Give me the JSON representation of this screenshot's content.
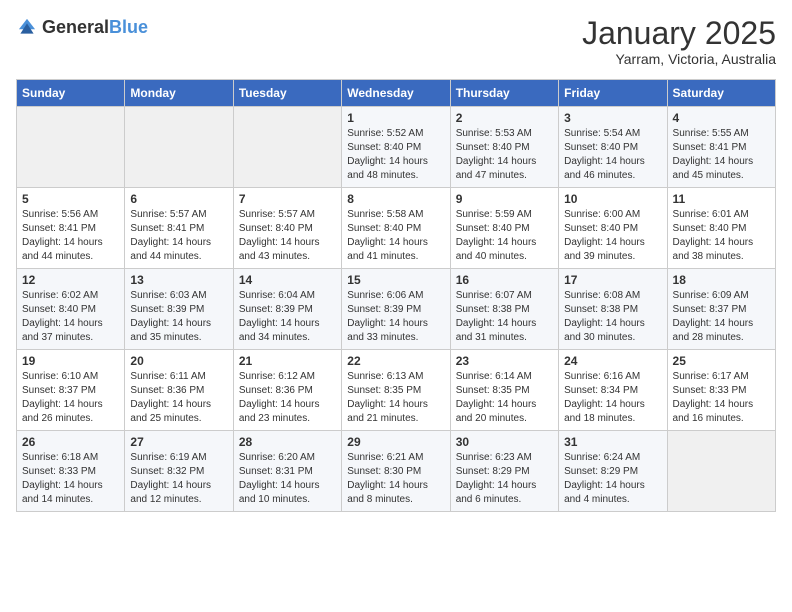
{
  "header": {
    "logo_general": "General",
    "logo_blue": "Blue",
    "title": "January 2025",
    "subtitle": "Yarram, Victoria, Australia"
  },
  "calendar": {
    "days_of_week": [
      "Sunday",
      "Monday",
      "Tuesday",
      "Wednesday",
      "Thursday",
      "Friday",
      "Saturday"
    ],
    "weeks": [
      [
        {
          "day": "",
          "info": ""
        },
        {
          "day": "",
          "info": ""
        },
        {
          "day": "",
          "info": ""
        },
        {
          "day": "1",
          "info": "Sunrise: 5:52 AM\nSunset: 8:40 PM\nDaylight: 14 hours\nand 48 minutes."
        },
        {
          "day": "2",
          "info": "Sunrise: 5:53 AM\nSunset: 8:40 PM\nDaylight: 14 hours\nand 47 minutes."
        },
        {
          "day": "3",
          "info": "Sunrise: 5:54 AM\nSunset: 8:40 PM\nDaylight: 14 hours\nand 46 minutes."
        },
        {
          "day": "4",
          "info": "Sunrise: 5:55 AM\nSunset: 8:41 PM\nDaylight: 14 hours\nand 45 minutes."
        }
      ],
      [
        {
          "day": "5",
          "info": "Sunrise: 5:56 AM\nSunset: 8:41 PM\nDaylight: 14 hours\nand 44 minutes."
        },
        {
          "day": "6",
          "info": "Sunrise: 5:57 AM\nSunset: 8:41 PM\nDaylight: 14 hours\nand 44 minutes."
        },
        {
          "day": "7",
          "info": "Sunrise: 5:57 AM\nSunset: 8:40 PM\nDaylight: 14 hours\nand 43 minutes."
        },
        {
          "day": "8",
          "info": "Sunrise: 5:58 AM\nSunset: 8:40 PM\nDaylight: 14 hours\nand 41 minutes."
        },
        {
          "day": "9",
          "info": "Sunrise: 5:59 AM\nSunset: 8:40 PM\nDaylight: 14 hours\nand 40 minutes."
        },
        {
          "day": "10",
          "info": "Sunrise: 6:00 AM\nSunset: 8:40 PM\nDaylight: 14 hours\nand 39 minutes."
        },
        {
          "day": "11",
          "info": "Sunrise: 6:01 AM\nSunset: 8:40 PM\nDaylight: 14 hours\nand 38 minutes."
        }
      ],
      [
        {
          "day": "12",
          "info": "Sunrise: 6:02 AM\nSunset: 8:40 PM\nDaylight: 14 hours\nand 37 minutes."
        },
        {
          "day": "13",
          "info": "Sunrise: 6:03 AM\nSunset: 8:39 PM\nDaylight: 14 hours\nand 35 minutes."
        },
        {
          "day": "14",
          "info": "Sunrise: 6:04 AM\nSunset: 8:39 PM\nDaylight: 14 hours\nand 34 minutes."
        },
        {
          "day": "15",
          "info": "Sunrise: 6:06 AM\nSunset: 8:39 PM\nDaylight: 14 hours\nand 33 minutes."
        },
        {
          "day": "16",
          "info": "Sunrise: 6:07 AM\nSunset: 8:38 PM\nDaylight: 14 hours\nand 31 minutes."
        },
        {
          "day": "17",
          "info": "Sunrise: 6:08 AM\nSunset: 8:38 PM\nDaylight: 14 hours\nand 30 minutes."
        },
        {
          "day": "18",
          "info": "Sunrise: 6:09 AM\nSunset: 8:37 PM\nDaylight: 14 hours\nand 28 minutes."
        }
      ],
      [
        {
          "day": "19",
          "info": "Sunrise: 6:10 AM\nSunset: 8:37 PM\nDaylight: 14 hours\nand 26 minutes."
        },
        {
          "day": "20",
          "info": "Sunrise: 6:11 AM\nSunset: 8:36 PM\nDaylight: 14 hours\nand 25 minutes."
        },
        {
          "day": "21",
          "info": "Sunrise: 6:12 AM\nSunset: 8:36 PM\nDaylight: 14 hours\nand 23 minutes."
        },
        {
          "day": "22",
          "info": "Sunrise: 6:13 AM\nSunset: 8:35 PM\nDaylight: 14 hours\nand 21 minutes."
        },
        {
          "day": "23",
          "info": "Sunrise: 6:14 AM\nSunset: 8:35 PM\nDaylight: 14 hours\nand 20 minutes."
        },
        {
          "day": "24",
          "info": "Sunrise: 6:16 AM\nSunset: 8:34 PM\nDaylight: 14 hours\nand 18 minutes."
        },
        {
          "day": "25",
          "info": "Sunrise: 6:17 AM\nSunset: 8:33 PM\nDaylight: 14 hours\nand 16 minutes."
        }
      ],
      [
        {
          "day": "26",
          "info": "Sunrise: 6:18 AM\nSunset: 8:33 PM\nDaylight: 14 hours\nand 14 minutes."
        },
        {
          "day": "27",
          "info": "Sunrise: 6:19 AM\nSunset: 8:32 PM\nDaylight: 14 hours\nand 12 minutes."
        },
        {
          "day": "28",
          "info": "Sunrise: 6:20 AM\nSunset: 8:31 PM\nDaylight: 14 hours\nand 10 minutes."
        },
        {
          "day": "29",
          "info": "Sunrise: 6:21 AM\nSunset: 8:30 PM\nDaylight: 14 hours\nand 8 minutes."
        },
        {
          "day": "30",
          "info": "Sunrise: 6:23 AM\nSunset: 8:29 PM\nDaylight: 14 hours\nand 6 minutes."
        },
        {
          "day": "31",
          "info": "Sunrise: 6:24 AM\nSunset: 8:29 PM\nDaylight: 14 hours\nand 4 minutes."
        },
        {
          "day": "",
          "info": ""
        }
      ]
    ]
  }
}
